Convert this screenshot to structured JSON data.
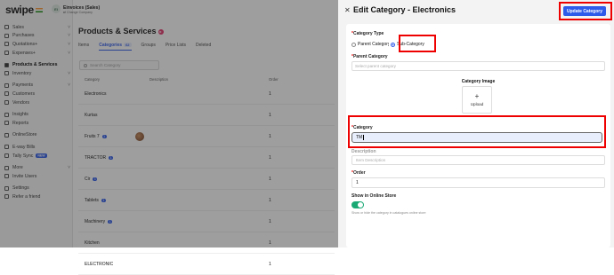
{
  "sidebar": {
    "logo": "swipe",
    "items": [
      {
        "label": "Sales",
        "chev": "˅",
        "active": false
      },
      {
        "label": "Purchases",
        "chev": "˅",
        "active": false
      },
      {
        "label": "Quotations+",
        "chev": "˅",
        "active": false
      },
      {
        "label": "Expenses+",
        "chev": "˅",
        "active": false
      },
      {
        "label": "Products & Services",
        "chev": "",
        "active": true
      },
      {
        "label": "Inventory",
        "chev": "˅",
        "active": false
      },
      {
        "label": "Payments",
        "chev": "˅",
        "active": false
      },
      {
        "label": "Customers",
        "chev": "",
        "active": false
      },
      {
        "label": "Vendors",
        "chev": "",
        "active": false
      },
      {
        "label": "Insights",
        "chev": "",
        "active": false
      },
      {
        "label": "Reports",
        "chev": "",
        "active": false
      },
      {
        "label": "OnlineStore",
        "chev": "",
        "active": false
      },
      {
        "label": "E-way Bills",
        "chev": "",
        "active": false
      },
      {
        "label": "Tally Sync",
        "chev": "",
        "active": false,
        "badge": "NEW"
      },
      {
        "label": "More",
        "chev": "˅",
        "active": false
      },
      {
        "label": "Invite Users",
        "chev": "",
        "active": false
      },
      {
        "label": "Settings",
        "chev": "",
        "active": false
      },
      {
        "label": "Refer a friend",
        "chev": "",
        "active": false
      }
    ]
  },
  "org": {
    "initials": "EI",
    "name": "Einvoices (Sales)",
    "change": "⇄ Change Company"
  },
  "main": {
    "title": "Products & Services",
    "tabs": [
      {
        "label": "Items",
        "active": false
      },
      {
        "label": "Categories",
        "count": "62",
        "active": true
      },
      {
        "label": "Groups",
        "active": false
      },
      {
        "label": "Price Lists",
        "active": false
      },
      {
        "label": "Deleted",
        "active": false
      }
    ],
    "search_placeholder": "Search Category",
    "columns": [
      "Category",
      "Description",
      "Order"
    ],
    "rows": [
      {
        "name": "Electronics",
        "count": "",
        "order": "1",
        "img": false
      },
      {
        "name": "Kurtas",
        "count": "",
        "order": "1",
        "img": false
      },
      {
        "name": "Fruits 7",
        "count": "1",
        "order": "1",
        "img": true
      },
      {
        "name": "TRACTOR",
        "count": "1",
        "order": "1",
        "img": false
      },
      {
        "name": "Cir",
        "count": "1",
        "order": "1",
        "img": false
      },
      {
        "name": "Tablets",
        "count": "1",
        "order": "1",
        "img": false
      },
      {
        "name": "Machinery",
        "count": "1",
        "order": "1",
        "img": false
      },
      {
        "name": "Kitchen",
        "count": "",
        "order": "1",
        "img": false
      },
      {
        "name": "ELECTRONIC",
        "count": "",
        "order": "1",
        "img": false
      }
    ]
  },
  "drawer": {
    "close": "✕",
    "title": "Edit Category - Electronics",
    "update_label": "Update Category",
    "category_type_label": "Category Type",
    "parent_option": "Parent Category",
    "sub_option": "Sub-Category",
    "parent_category_label": "Parent Category",
    "parent_category_placeholder": "Select parent category",
    "image_label": "Category Image",
    "upload_plus": "+",
    "upload_label": "Upload",
    "category_label": "Category",
    "category_value": "TM",
    "description_label": "Description",
    "description_placeholder": "Item Description",
    "order_label": "Order",
    "order_value": "1",
    "online_label": "Show in Online Store",
    "online_hint": "Show or hide the category in catalogues online store",
    "required_mark": "*"
  }
}
